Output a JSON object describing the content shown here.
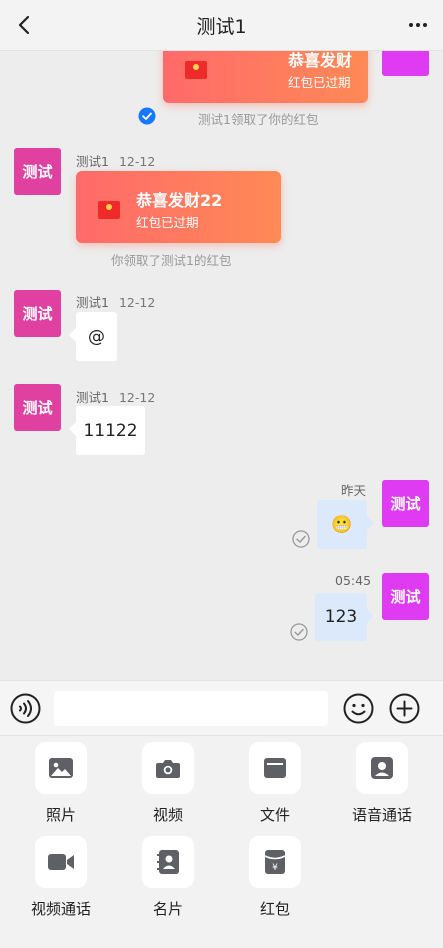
{
  "header": {
    "title": "测试1"
  },
  "messages": {
    "m1": {
      "packet_title": "恭喜发财",
      "packet_status": "红包已过期",
      "notice": "测试1领取了你的红包"
    },
    "m2": {
      "avatar_text": "测试",
      "sender": "测试1",
      "time": "12-12",
      "packet_title": "恭喜发财22",
      "packet_status": "红包已过期",
      "notice": "你领取了测试1的红包"
    },
    "m3": {
      "avatar_text": "测试",
      "sender": "测试1",
      "time": "12-12",
      "text": "@"
    },
    "m4": {
      "avatar_text": "测试",
      "sender": "测试1",
      "time": "12-12",
      "text": "11122"
    },
    "m5": {
      "avatar_text": "测试",
      "time": "昨天",
      "text": "😬"
    },
    "m6": {
      "avatar_text": "测试",
      "time": "05:45",
      "text": "123"
    }
  },
  "input": {
    "value": "",
    "placeholder": ""
  },
  "tools": [
    {
      "label": "照片",
      "icon": "image-icon"
    },
    {
      "label": "视频",
      "icon": "camera-icon"
    },
    {
      "label": "文件",
      "icon": "folder-icon"
    },
    {
      "label": "语音通话",
      "icon": "voice-call-icon"
    },
    {
      "label": "视频通话",
      "icon": "video-call-icon"
    },
    {
      "label": "名片",
      "icon": "contact-card-icon"
    },
    {
      "label": "红包",
      "icon": "red-packet-icon"
    }
  ],
  "colors": {
    "left_avatar": "#e0409f",
    "right_avatar": "#de3bf2",
    "red_packet": "#ff7560",
    "own_bubble": "#dbe9fb",
    "read_check_blue": "#1677ff"
  }
}
